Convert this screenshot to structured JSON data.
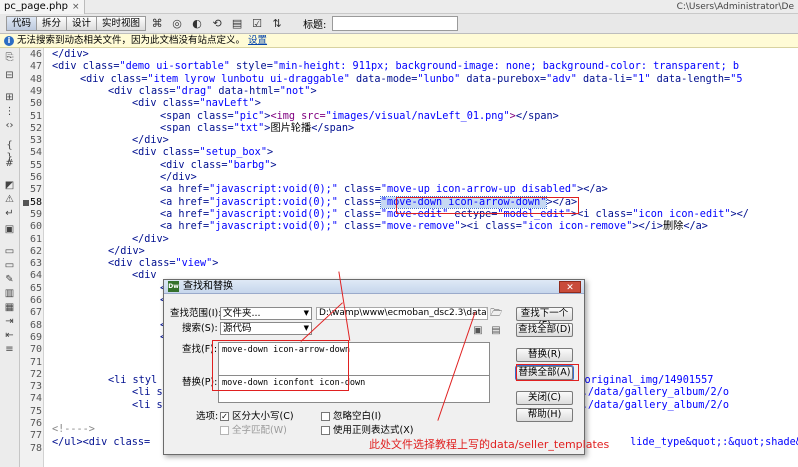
{
  "tab": {
    "filename": "pc_page.php",
    "close": "×",
    "path": "C:\\Users\\Administrator\\De"
  },
  "toolbar": {
    "view_code": "代码",
    "view_split": "拆分",
    "view_design": "设计",
    "view_live": "实时视图",
    "title_label": "标题:",
    "title_value": ""
  },
  "infobar": {
    "message": "无法搜索到动态相关文件，因为此文档没有站点定义。",
    "link": "设置"
  },
  "code": {
    "line_numbers": [
      "46",
      "47",
      "48",
      "49",
      "50",
      "51",
      "52",
      "53",
      "54",
      "55",
      "56",
      "57",
      "58",
      "59",
      "60",
      "61",
      "62",
      "63",
      "64",
      "65",
      "66",
      "67",
      "68",
      "69",
      "70",
      "71",
      "72",
      "73",
      "74",
      "75",
      "76",
      "77",
      "78"
    ]
  },
  "dialog": {
    "title": "查找和替换",
    "close": "✕",
    "scope_label": "查找范围(I):",
    "scope_value": "文件夹...",
    "scope_path": "D:\\wamp\\www\\ecmoban_dsc2.3\\data\\seller_temp",
    "search_label": "搜索(S):",
    "search_value": "源代码",
    "find_label": "查找(F):",
    "find_value": "move-down icon-arrow-down",
    "replace_label": "替换(P):",
    "replace_value": "move-down iconfont icon-down",
    "options_label": "选项:",
    "opt_case": "区分大小写(C)",
    "opt_whole": "全字匹配(W)",
    "opt_whitespace": "忽略空白(I)",
    "opt_regex": "使用正则表达式(X)",
    "btn_find_next": "查找下一个(F)",
    "btn_find_all": "查找全部(D)",
    "btn_replace": "替换(R)",
    "btn_replace_all": "替换全部(A)",
    "btn_close": "关闭(C)",
    "btn_help": "帮助(H)",
    "chk_case": true,
    "chk_whole": false,
    "chk_whitespace": false,
    "chk_regex": false
  },
  "annotation": {
    "text": "此处文件选择教程上写的data/seller_templates",
    "color": "#e02020"
  }
}
